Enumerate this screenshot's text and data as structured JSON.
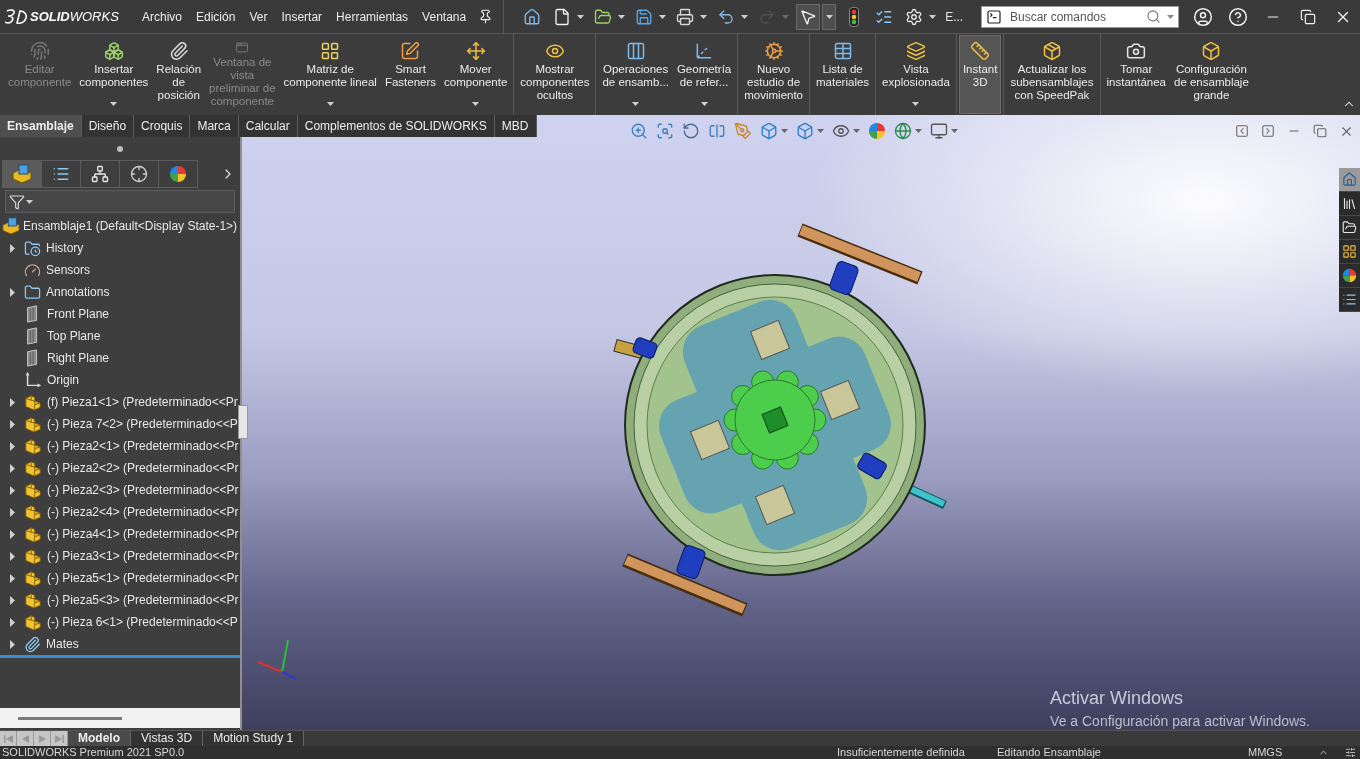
{
  "menu_bar": {
    "logo": "**SOLID**WORKS",
    "menus": [
      "Archivo",
      "Edición",
      "Ver",
      "Insertar",
      "Herramientas",
      "Ventana"
    ],
    "quick_access": [
      {
        "kind": "home",
        "dropdown": false,
        "disabled": false,
        "pressed": false
      },
      {
        "kind": "new",
        "dropdown": true,
        "disabled": false,
        "pressed": false
      },
      {
        "kind": "open",
        "dropdown": true,
        "disabled": false,
        "pressed": false
      },
      {
        "kind": "save",
        "dropdown": true,
        "disabled": false,
        "pressed": false
      },
      {
        "kind": "print",
        "dropdown": true,
        "disabled": false,
        "pressed": false
      },
      {
        "kind": "undo",
        "dropdown": true,
        "disabled": false,
        "pressed": false
      },
      {
        "kind": "redo",
        "dropdown": true,
        "disabled": true,
        "pressed": false
      },
      {
        "kind": "select",
        "dropdown": true,
        "disabled": false,
        "pressed": true
      },
      {
        "kind": "rebuild",
        "dropdown": false,
        "disabled": false,
        "pressed": false
      },
      {
        "kind": "properties",
        "dropdown": false,
        "disabled": false,
        "pressed": false
      },
      {
        "kind": "options",
        "dropdown": true,
        "disabled": false,
        "pressed": false
      }
    ],
    "overflow_label": "E...",
    "search": {
      "placeholder": "Buscar comandos"
    }
  },
  "ribbon": {
    "groups": [
      {
        "items": [
          {
            "kind": "edit-component",
            "label": "Editar\ncomponente",
            "disabled": true,
            "dropdown": false,
            "pressed": false
          },
          {
            "kind": "insert-components",
            "label": "Insertar\ncomponentes",
            "disabled": false,
            "dropdown": true,
            "pressed": false
          },
          {
            "kind": "mate",
            "label": "Relación\nde\nposición",
            "disabled": false,
            "dropdown": false,
            "pressed": false
          },
          {
            "kind": "preview-window",
            "label": "Ventana de\nvista\npreliminar de\ncomponente",
            "disabled": true,
            "dropdown": false,
            "pressed": false
          },
          {
            "kind": "linear-pattern",
            "label": "Matriz de\ncomponente lineal",
            "disabled": false,
            "dropdown": true,
            "pressed": false
          },
          {
            "kind": "smart-fasteners",
            "label": "Smart\nFasteners",
            "disabled": false,
            "dropdown": false,
            "pressed": false
          },
          {
            "kind": "move-component",
            "label": "Mover\ncomponente",
            "disabled": false,
            "dropdown": true,
            "pressed": false
          }
        ]
      },
      {
        "items": [
          {
            "kind": "show-hidden",
            "label": "Mostrar\ncomponentes\nocultos",
            "disabled": false,
            "dropdown": false,
            "pressed": false
          }
        ]
      },
      {
        "items": [
          {
            "kind": "assembly-features",
            "label": "Operaciones\nde ensamb...",
            "disabled": false,
            "dropdown": true,
            "pressed": false
          },
          {
            "kind": "reference-geometry",
            "label": "Geometría\nde refer...",
            "disabled": false,
            "dropdown": true,
            "pressed": false
          }
        ]
      },
      {
        "items": [
          {
            "kind": "motion-study",
            "label": "Nuevo\nestudio de\nmovimiento",
            "disabled": false,
            "dropdown": false,
            "pressed": false
          }
        ]
      },
      {
        "items": [
          {
            "kind": "bill-of-materials",
            "label": "Lista de\nmateriales",
            "disabled": false,
            "dropdown": false,
            "pressed": false
          }
        ]
      },
      {
        "items": [
          {
            "kind": "exploded-view",
            "label": "Vista\nexplosionada",
            "disabled": false,
            "dropdown": true,
            "pressed": false
          }
        ]
      },
      {
        "items": [
          {
            "kind": "instant-3d",
            "label": "Instant\n3D",
            "disabled": false,
            "dropdown": false,
            "pressed": true
          }
        ]
      },
      {
        "items": [
          {
            "kind": "speedpak",
            "label": "Actualizar los\nsubensamblajes\ncon SpeedPak",
            "disabled": false,
            "dropdown": false,
            "pressed": false
          }
        ]
      },
      {
        "items": [
          {
            "kind": "snapshot",
            "label": "Tomar\ninstantánea",
            "disabled": false,
            "dropdown": false,
            "pressed": false
          },
          {
            "kind": "large-assembly",
            "label": "Configuración\nde ensamblaje\ngrande",
            "disabled": false,
            "dropdown": false,
            "pressed": false
          }
        ]
      }
    ]
  },
  "command_tabs": [
    {
      "label": "Ensamblaje",
      "selected": true
    },
    {
      "label": "Diseño",
      "selected": false
    },
    {
      "label": "Croquis",
      "selected": false
    },
    {
      "label": "Marca",
      "selected": false
    },
    {
      "label": "Calcular",
      "selected": false
    },
    {
      "label": "Complementos de SOLIDWORKS",
      "selected": false
    },
    {
      "label": "MBD",
      "selected": false
    }
  ],
  "feature_manager": {
    "panel_tabs": [
      {
        "kind": "feature-tree",
        "selected": true
      },
      {
        "kind": "property-manager",
        "selected": false
      },
      {
        "kind": "configuration",
        "selected": false
      },
      {
        "kind": "dimxpert",
        "selected": false
      },
      {
        "kind": "display",
        "selected": false
      }
    ],
    "tree": {
      "label": "Ensamblaje1 (Default<Display State-1>)",
      "kind": "assembly",
      "expandable": false,
      "children": [
        {
          "label": "History",
          "kind": "history",
          "expandable": true
        },
        {
          "label": "Sensors",
          "kind": "sensors",
          "expandable": false
        },
        {
          "label": "Annotations",
          "kind": "annotations",
          "expandable": true
        },
        {
          "label": "Front Plane",
          "kind": "plane",
          "expandable": false
        },
        {
          "label": "Top Plane",
          "kind": "plane",
          "expandable": false
        },
        {
          "label": "Right Plane",
          "kind": "plane",
          "expandable": false
        },
        {
          "label": "Origin",
          "kind": "origin",
          "expandable": false
        },
        {
          "label": "(f) Pieza1<1> (Predeterminado<<Pr",
          "kind": "part",
          "expandable": true
        },
        {
          "label": "(-) Pieza 7<2> (Predeterminado<<P",
          "kind": "part",
          "expandable": true
        },
        {
          "label": "(-) Pieza2<1> (Predeterminado<<Pr",
          "kind": "part",
          "expandable": true
        },
        {
          "label": "(-) Pieza2<2> (Predeterminado<<Pr",
          "kind": "part",
          "expandable": true
        },
        {
          "label": "(-) Pieza2<3> (Predeterminado<<Pr",
          "kind": "part",
          "expandable": true
        },
        {
          "label": "(-) Pieza2<4> (Predeterminado<<Pr",
          "kind": "part",
          "expandable": true
        },
        {
          "label": "(-) Pieza4<1> (Predeterminado<<Pr",
          "kind": "part",
          "expandable": true
        },
        {
          "label": "(-) Pieza3<1> (Predeterminado<<Pr",
          "kind": "part",
          "expandable": true
        },
        {
          "label": "(-) Pieza5<1> (Predeterminado<<Pr",
          "kind": "part",
          "expandable": true
        },
        {
          "label": "(-) Pieza5<3> (Predeterminado<<Pr",
          "kind": "part",
          "expandable": true
        },
        {
          "label": "(-) Pieza 6<1> (Predeterminado<<P",
          "kind": "part",
          "expandable": true
        },
        {
          "label": "Mates",
          "kind": "mates",
          "expandable": true
        }
      ]
    }
  },
  "graphics_area": {
    "heads_up_toolbar": [
      {
        "kind": "zoom-fit",
        "dropdown": false
      },
      {
        "kind": "zoom-area",
        "dropdown": false
      },
      {
        "kind": "previous-view",
        "dropdown": false
      },
      {
        "kind": "section-view",
        "dropdown": false
      },
      {
        "kind": "dynamic-annotation",
        "dropdown": false
      },
      {
        "kind": "view-orientation",
        "dropdown": true
      },
      {
        "kind": "display-style",
        "dropdown": true
      },
      {
        "kind": "hide-show",
        "dropdown": true
      },
      {
        "kind": "edit-appearance",
        "dropdown": false
      },
      {
        "kind": "apply-scene",
        "dropdown": true
      },
      {
        "kind": "view-settings",
        "dropdown": true
      }
    ],
    "task_pane": [
      {
        "kind": "home",
        "selected": true
      },
      {
        "kind": "design-library",
        "selected": false
      },
      {
        "kind": "file-explorer",
        "selected": false
      },
      {
        "kind": "view-palette",
        "selected": false
      },
      {
        "kind": "appearances",
        "selected": false
      },
      {
        "kind": "custom-properties",
        "selected": false
      }
    ],
    "activation_notice": {
      "title": "Activar Windows",
      "message": "Ve a Configuración para activar Windows."
    }
  },
  "model_tabs": [
    {
      "label": "Modelo",
      "selected": true
    },
    {
      "label": "Vistas 3D",
      "selected": false
    },
    {
      "label": "Motion Study 1",
      "selected": false
    }
  ],
  "status_bar": {
    "product": "SOLIDWORKS Premium 2021 SP0.0",
    "definition": "Insuficientemente definida",
    "mode": "Editando Ensamblaje",
    "units": "MMGS"
  }
}
